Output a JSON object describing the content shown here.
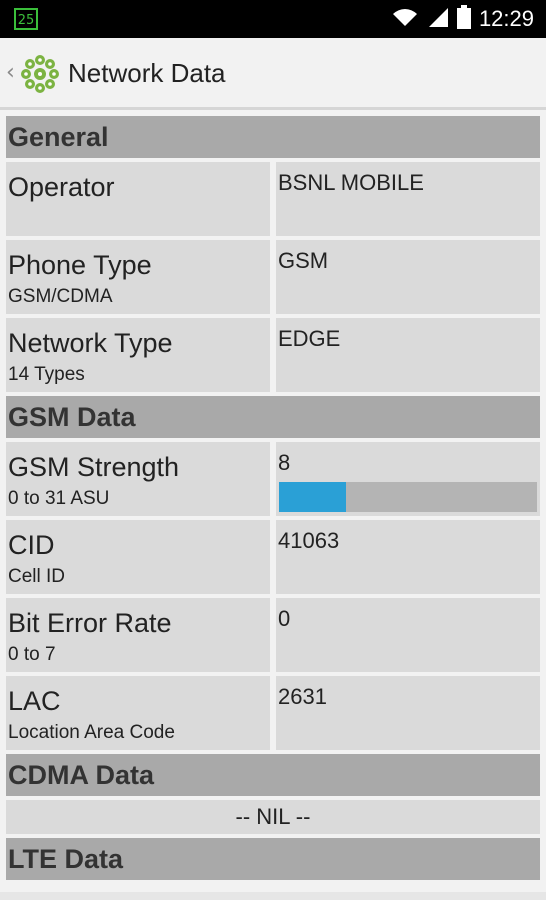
{
  "status_bar": {
    "badge": "25",
    "time": "12:29",
    "icons": [
      "wifi-icon",
      "signal-icon",
      "battery-icon"
    ]
  },
  "action_bar": {
    "title": "Network Data",
    "logo_icon": "network-logo-icon"
  },
  "sections": {
    "general": {
      "title": "General",
      "rows": [
        {
          "label": "Operator",
          "sub": "",
          "value": "BSNL MOBILE"
        },
        {
          "label": "Phone Type",
          "sub": "GSM/CDMA",
          "value": "GSM"
        },
        {
          "label": "Network Type",
          "sub": "14 Types",
          "value": "EDGE"
        }
      ]
    },
    "gsm": {
      "title": "GSM Data",
      "rows": [
        {
          "label": "GSM Strength",
          "sub": "0 to 31 ASU",
          "value": "8",
          "progress_fraction": 0.258
        },
        {
          "label": "CID",
          "sub": "Cell ID",
          "value": "41063"
        },
        {
          "label": "Bit Error Rate",
          "sub": "0 to 7",
          "value": "0"
        },
        {
          "label": "LAC",
          "sub": "Location Area Code",
          "value": "2631"
        }
      ]
    },
    "cdma": {
      "title": "CDMA Data",
      "nil_text": "-- NIL --"
    },
    "lte": {
      "title": "LTE Data"
    }
  },
  "colors": {
    "header_bg": "#a9a9a9",
    "cell_bg": "#dadada",
    "progress_fill": "#2aa0d6",
    "progress_track": "#b4b4b4"
  }
}
